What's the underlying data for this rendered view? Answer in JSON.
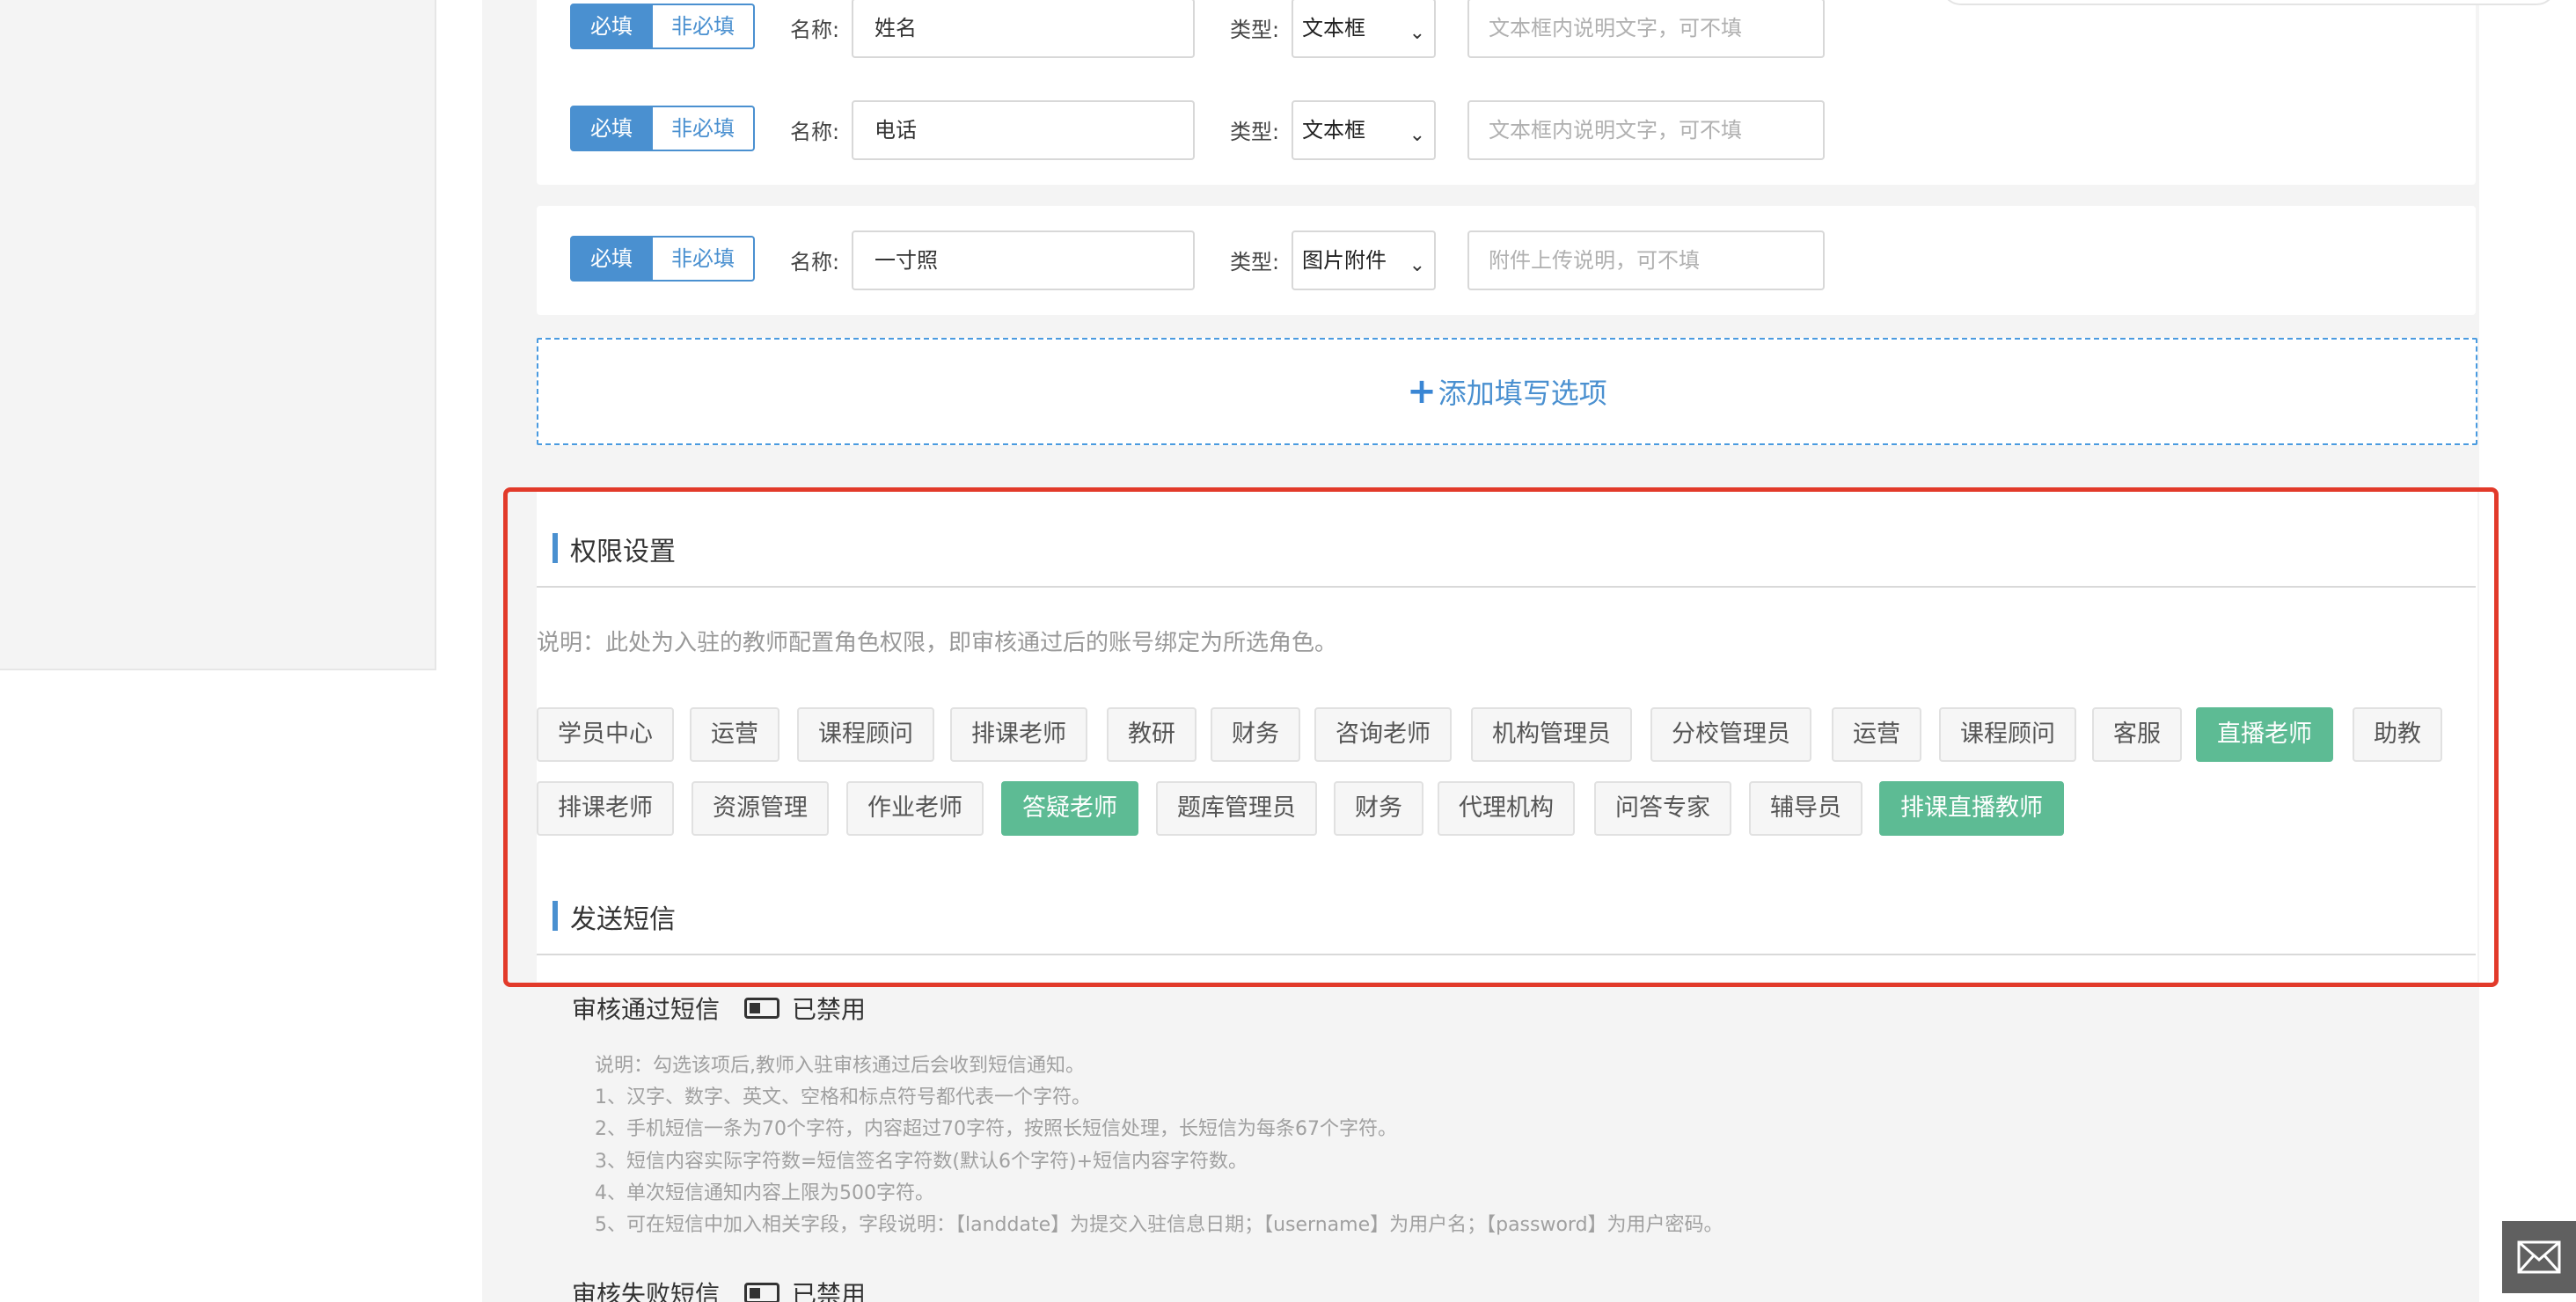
{
  "form_fields": [
    {
      "required_label": "必填",
      "optional_label": "非必填",
      "name_label": "名称:",
      "name_value": "姓名",
      "type_label": "类型:",
      "type_value": "文本框",
      "hint_placeholder": "文本框内说明文字，可不填"
    },
    {
      "required_label": "必填",
      "optional_label": "非必填",
      "name_label": "名称:",
      "name_value": "电话",
      "type_label": "类型:",
      "type_value": "文本框",
      "hint_placeholder": "文本框内说明文字，可不填"
    },
    {
      "required_label": "必填",
      "optional_label": "非必填",
      "name_label": "名称:",
      "name_value": "一寸照",
      "type_label": "类型:",
      "type_value": "图片附件",
      "hint_placeholder": "附件上传说明，可不填"
    }
  ],
  "add_option": {
    "icon": "plus-icon",
    "label": "添加填写选项"
  },
  "permissions": {
    "title": "权限设置",
    "description": "说明：此处为入驻的教师配置角色权限，即审核通过后的账号绑定为所选角色。",
    "roles_row1": [
      {
        "label": "学员中心",
        "selected": false
      },
      {
        "label": "运营",
        "selected": false
      },
      {
        "label": "课程顾问",
        "selected": false
      },
      {
        "label": "排课老师",
        "selected": false
      },
      {
        "label": "教研",
        "selected": false
      },
      {
        "label": "财务",
        "selected": false
      },
      {
        "label": "咨询老师",
        "selected": false
      },
      {
        "label": "机构管理员",
        "selected": false
      },
      {
        "label": "分校管理员",
        "selected": false
      },
      {
        "label": "运营",
        "selected": false
      },
      {
        "label": "课程顾问",
        "selected": false
      },
      {
        "label": "客服",
        "selected": false
      },
      {
        "label": "直播老师",
        "selected": true
      },
      {
        "label": "助教",
        "selected": false
      }
    ],
    "roles_row2": [
      {
        "label": "排课老师",
        "selected": false
      },
      {
        "label": "资源管理",
        "selected": false
      },
      {
        "label": "作业老师",
        "selected": false
      },
      {
        "label": "答疑老师",
        "selected": true
      },
      {
        "label": "题库管理员",
        "selected": false
      },
      {
        "label": "财务",
        "selected": false
      },
      {
        "label": "代理机构",
        "selected": false
      },
      {
        "label": "问答专家",
        "selected": false
      },
      {
        "label": "辅导员",
        "selected": false
      },
      {
        "label": "排课直播教师",
        "selected": true
      }
    ]
  },
  "sms": {
    "title": "发送短信",
    "approve_label": "审核通过短信",
    "approve_status": "已禁用",
    "notes": [
      "说明：勾选该项后,教师入驻审核通过后会收到短信通知。",
      "1、汉字、数字、英文、空格和标点符号都代表一个字符。",
      "2、手机短信一条为70个字符，内容超过70字符，按照长短信处理，长短信为每条67个字符。",
      "3、短信内容实际字符数=短信签名字符数(默认6个字符)+短信内容字符数。",
      "4、单次短信通知内容上限为500字符。",
      "5、可在短信中加入相关字段，字段说明：【landdate】为提交入驻信息日期；【username】为用户名；【password】为用户密码。"
    ],
    "reject_label": "审核失败短信",
    "reject_status": "已禁用"
  },
  "floating": {
    "mail_icon": "mail-icon"
  },
  "colors": {
    "accent": "#4a90d0",
    "selected_tag": "#5dbb94",
    "highlight_border": "#e23a2a"
  }
}
